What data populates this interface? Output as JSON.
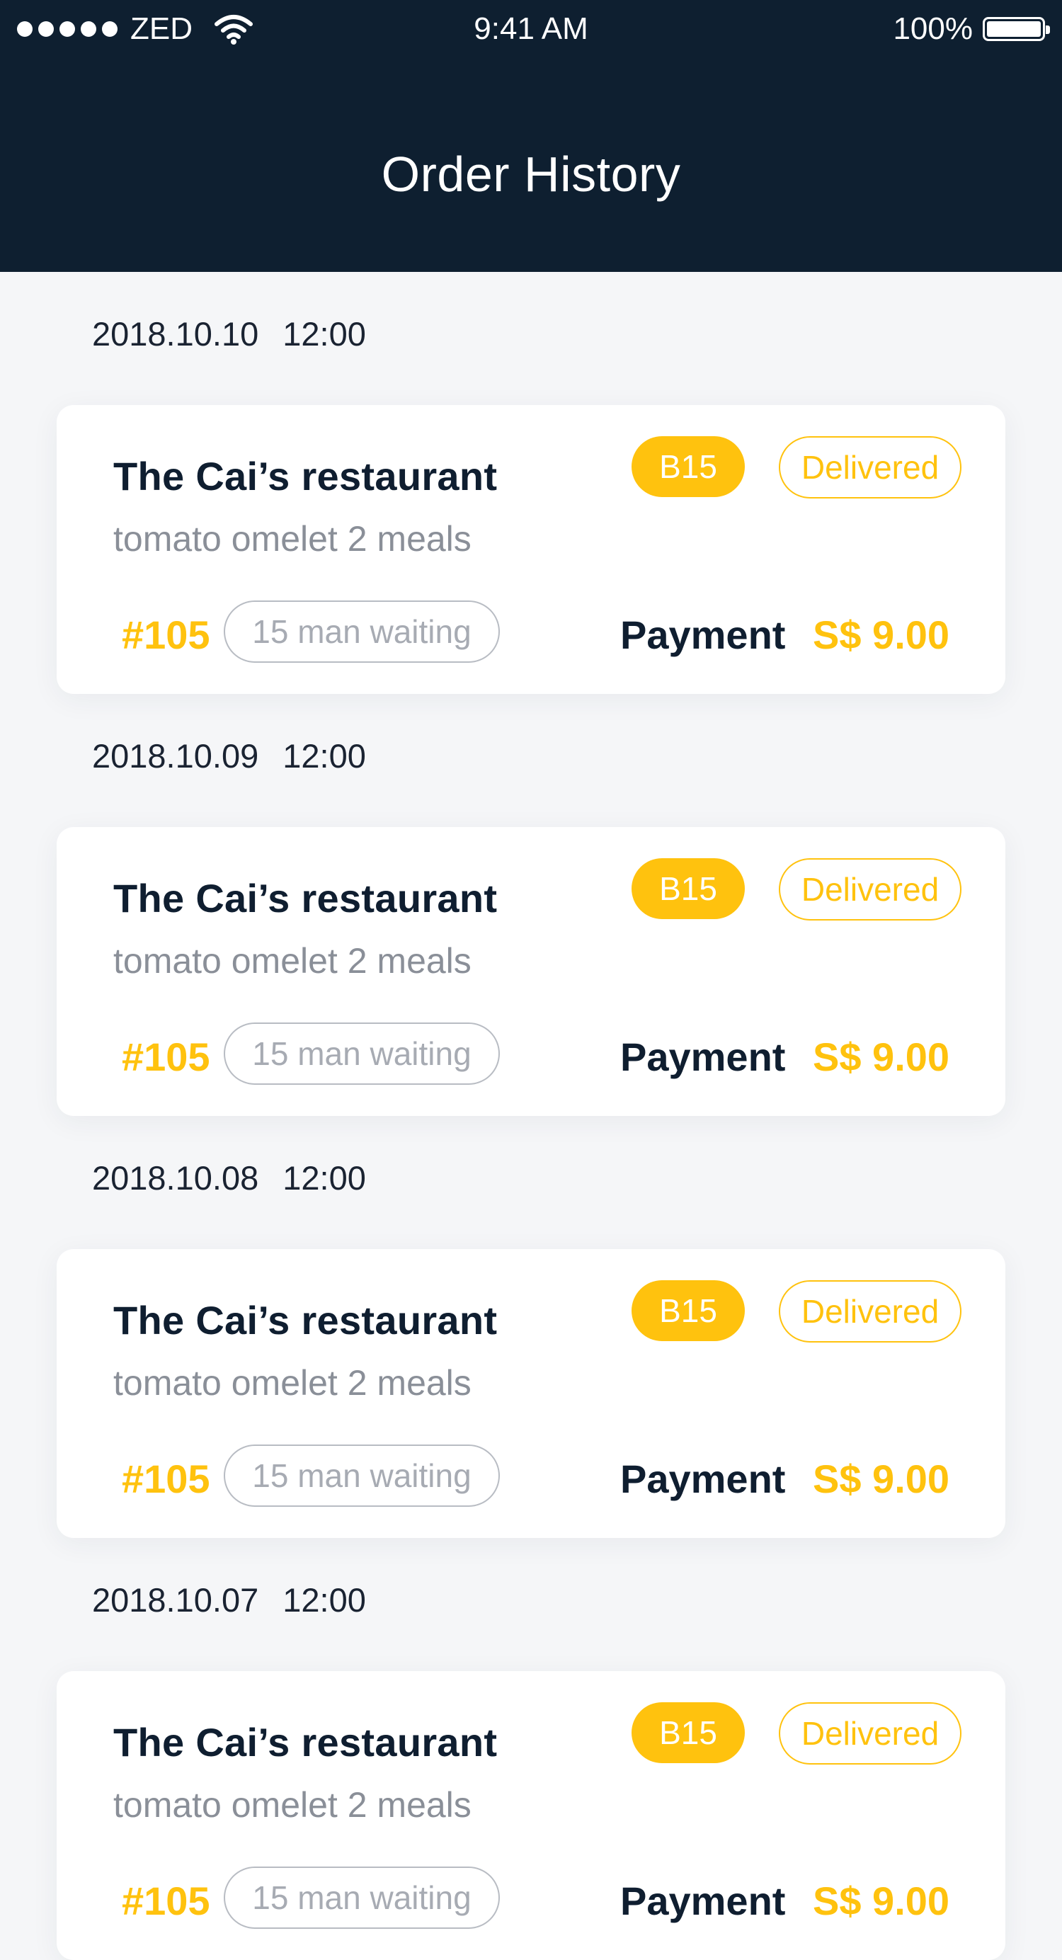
{
  "status_bar": {
    "carrier": "ZED",
    "time": "9:41 AM",
    "battery": "100%"
  },
  "header": {
    "title": "Order History"
  },
  "orders": [
    {
      "date": "2018.10.10",
      "time": "12:00",
      "restaurant": "The Cai’s restaurant",
      "table": "B15",
      "status": "Delivered",
      "meal": "tomato omelet 2 meals",
      "queue_number": "#105",
      "waiting": "15 man waiting",
      "payment_label": "Payment",
      "payment_amount": "S$ 9.00"
    },
    {
      "date": "2018.10.09",
      "time": "12:00",
      "restaurant": "The Cai’s restaurant",
      "table": "B15",
      "status": "Delivered",
      "meal": "tomato omelet 2 meals",
      "queue_number": "#105",
      "waiting": "15 man waiting",
      "payment_label": "Payment",
      "payment_amount": "S$ 9.00"
    },
    {
      "date": "2018.10.08",
      "time": "12:00",
      "restaurant": "The Cai’s restaurant",
      "table": "B15",
      "status": "Delivered",
      "meal": "tomato omelet 2 meals",
      "queue_number": "#105",
      "waiting": "15 man waiting",
      "payment_label": "Payment",
      "payment_amount": "S$ 9.00"
    },
    {
      "date": "2018.10.07",
      "time": "12:00",
      "restaurant": "The Cai’s restaurant",
      "table": "B15",
      "status": "Delivered",
      "meal": "tomato omelet 2 meals",
      "queue_number": "#105",
      "waiting": "15 man waiting",
      "payment_label": "Payment",
      "payment_amount": "S$ 9.00"
    }
  ],
  "colors": {
    "header_bg": "#0e1f30",
    "accent": "#ffc20e",
    "page_bg": "#f5f6f8"
  },
  "icons": {
    "signal": "signal-dots-icon",
    "wifi": "wifi-icon",
    "battery": "battery-icon"
  }
}
